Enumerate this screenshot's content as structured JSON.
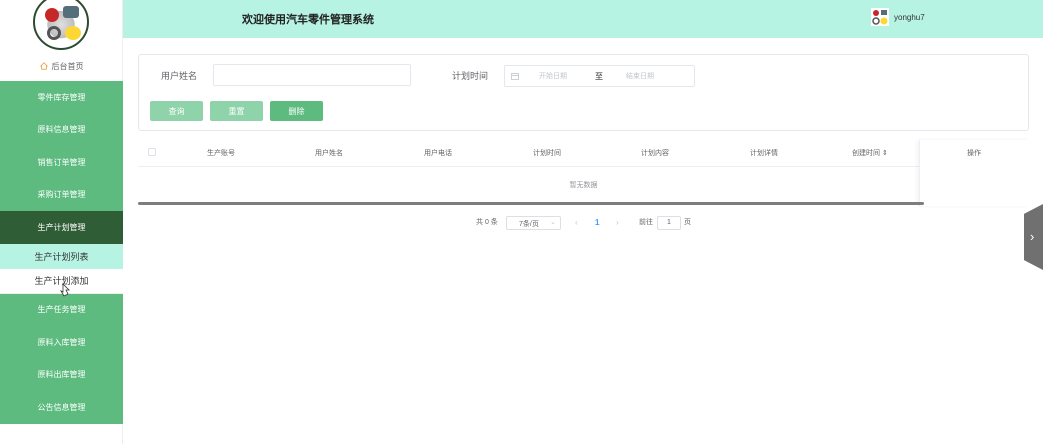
{
  "header": {
    "title": "欢迎使用汽车零件管理系统",
    "username": "yonghu7"
  },
  "sidebar": {
    "home_label": "后台首页",
    "items": [
      {
        "label": "零件库存管理"
      },
      {
        "label": "原料信息管理"
      },
      {
        "label": "销售订单管理"
      },
      {
        "label": "采购订单管理"
      },
      {
        "label": "生产计划管理"
      },
      {
        "label": "生产计划列表"
      },
      {
        "label": "生产计划添加"
      },
      {
        "label": "生产任务管理"
      },
      {
        "label": "原料入库管理"
      },
      {
        "label": "原料出库管理"
      },
      {
        "label": "公告信息管理"
      }
    ]
  },
  "search": {
    "username_label": "用户姓名",
    "username_value": "",
    "plan_time_label": "计划时间",
    "start_placeholder": "开始日期",
    "separator": "至",
    "end_placeholder": "结束日期",
    "query_button": "查询",
    "reset_button": "重置",
    "delete_button": "删除"
  },
  "table": {
    "columns": [
      "生产账号",
      "用户姓名",
      "用户电话",
      "计划时间",
      "计划内容",
      "计划详情",
      "创建时间 ⇕",
      "操作"
    ],
    "empty_text": "暂无数据"
  },
  "pagination": {
    "total_text": "共 0 条",
    "page_size": "7条/页",
    "current_page": "1",
    "goto_label": "前往",
    "goto_value": "1",
    "page_suffix": "页"
  },
  "colors": {
    "accent_green": "#5dbb7f",
    "active_menu": "#2f5e36",
    "header_bg": "#b6f3e3"
  }
}
